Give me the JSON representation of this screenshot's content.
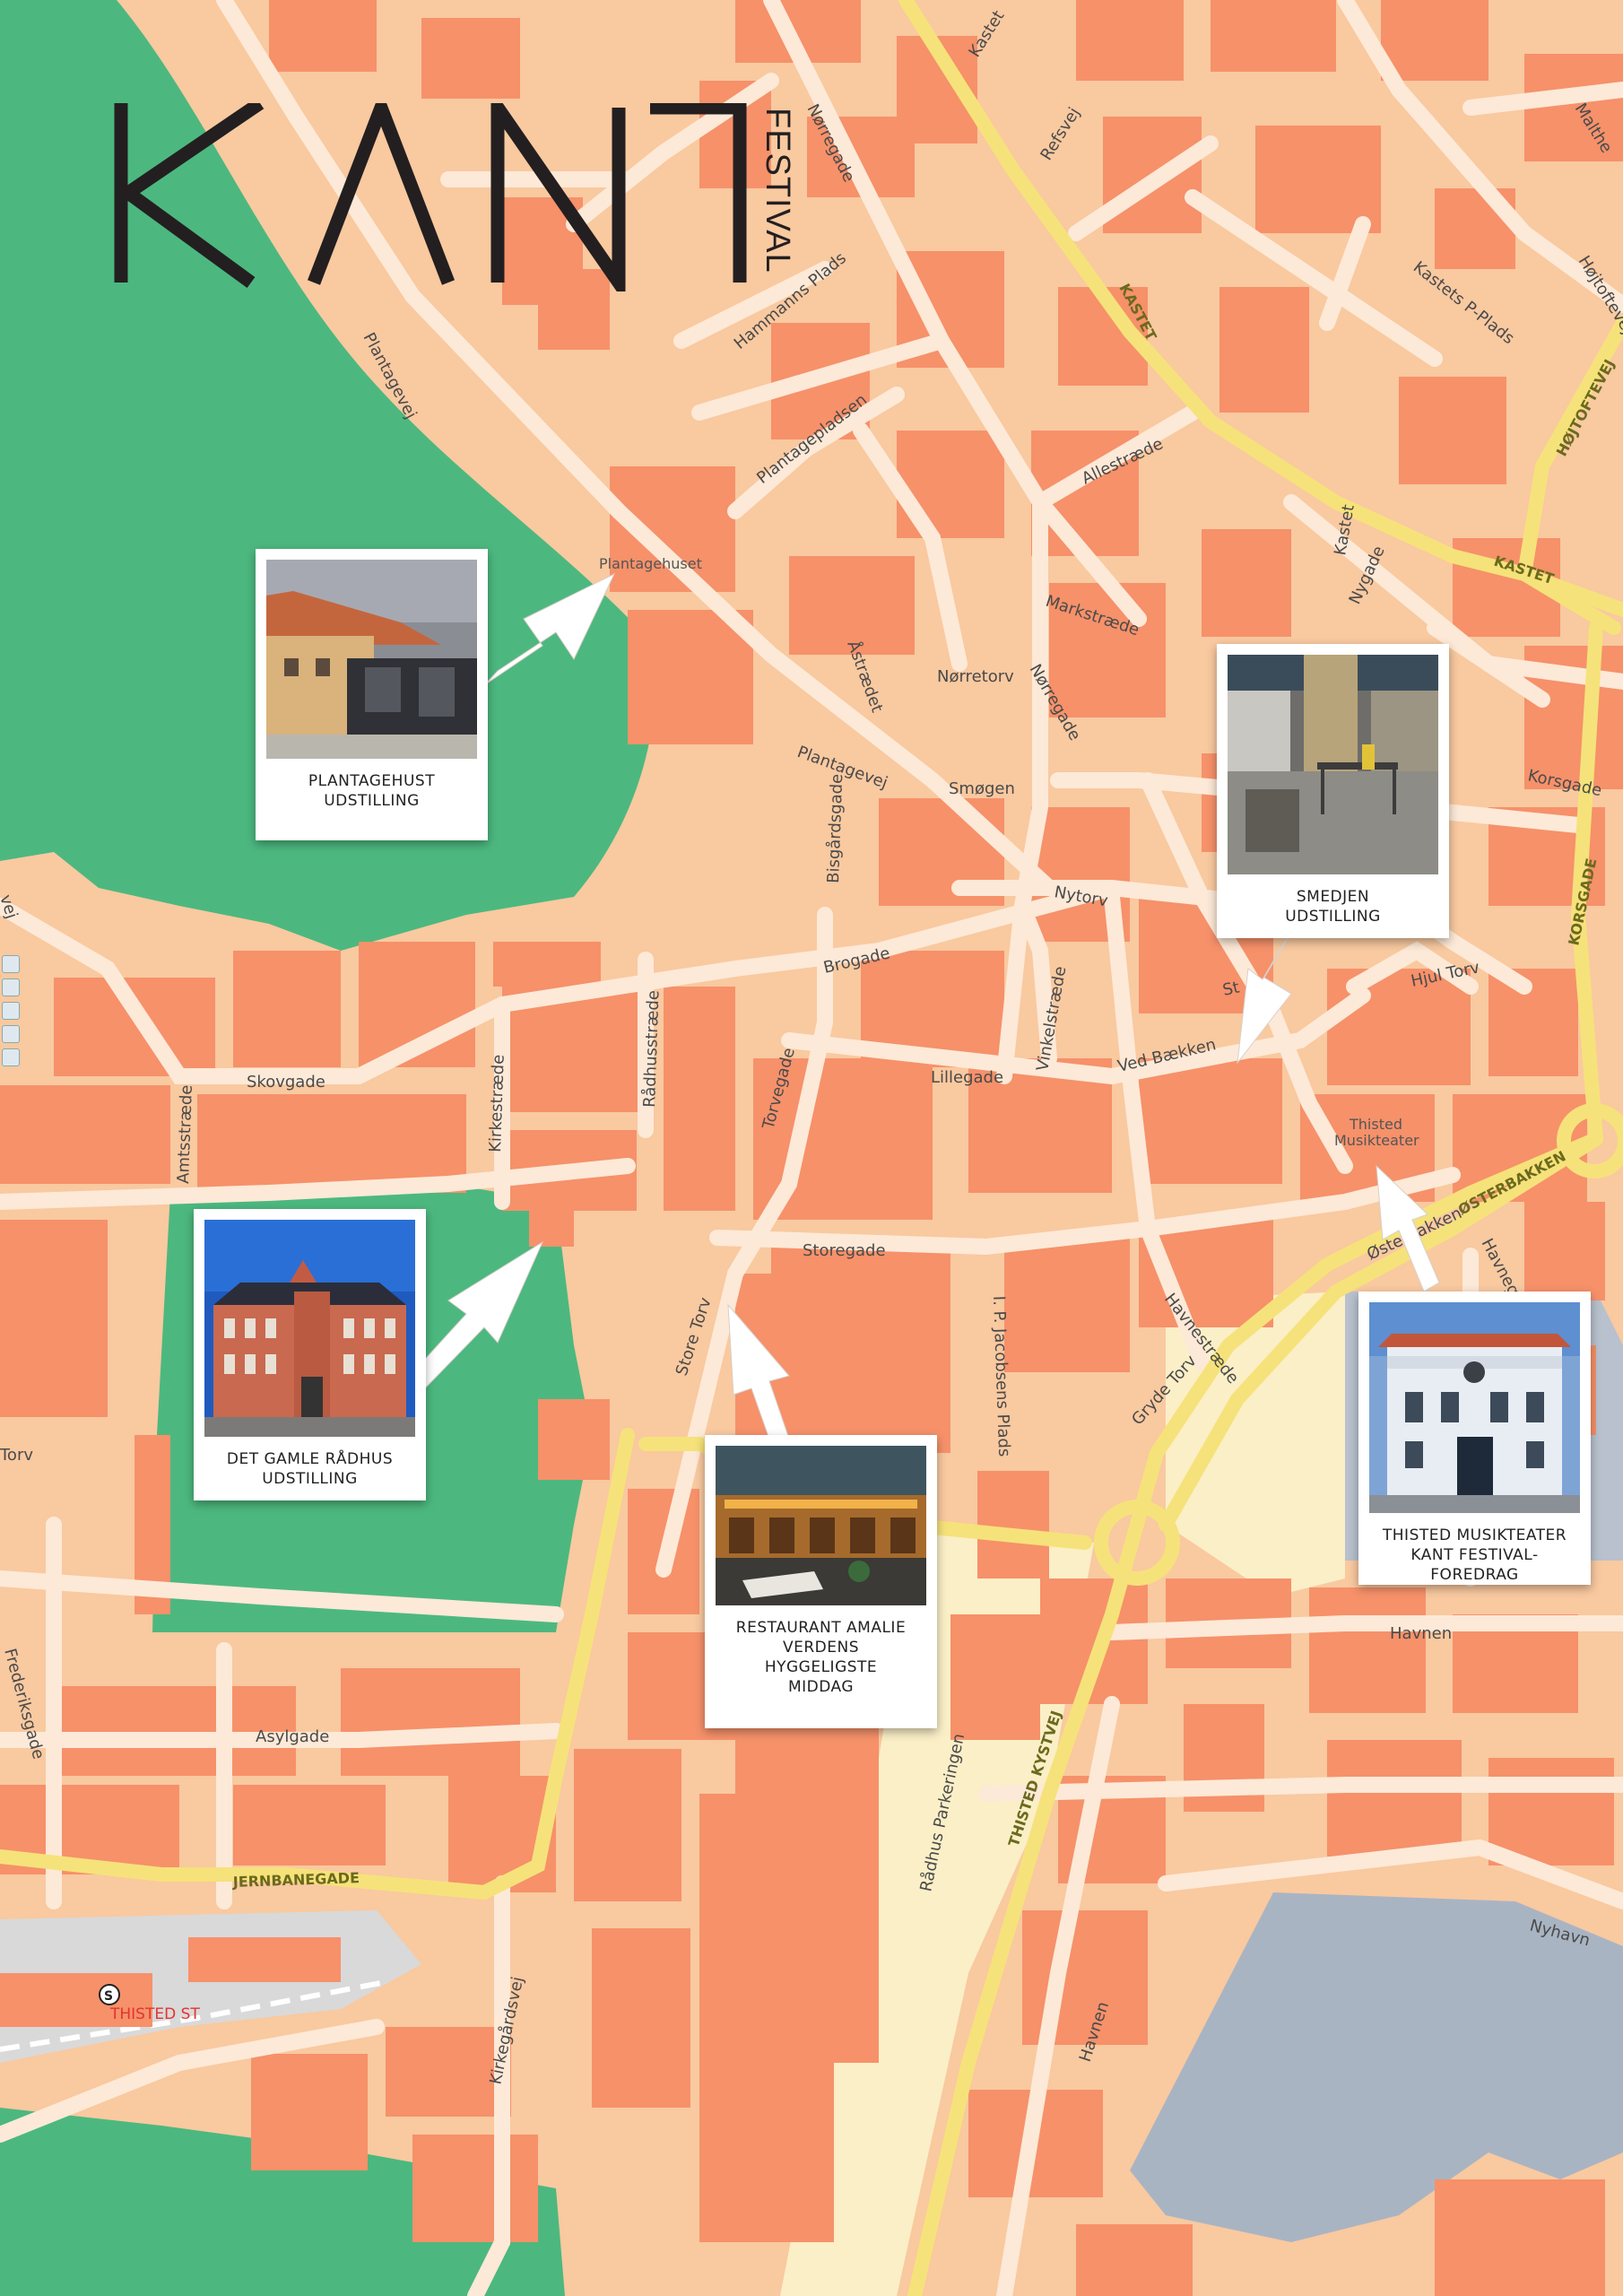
{
  "logo": {
    "word": "KANT",
    "side": "FESTIVAL"
  },
  "colors": {
    "park": "#4cb87f",
    "building": "#f6916a",
    "background": "#f9c9a0",
    "road": "#fce6d0",
    "major_road": "#f6e27a",
    "water": "#a9b4c3",
    "rail": "#d9d9d9",
    "arrow": "#ffffff"
  },
  "streets": [
    "Kastet",
    "Refsvej",
    "Nørregade",
    "Malthe",
    "Højtoftevej",
    "Kastets P-Plads",
    "KASTET",
    "HØJTOFTEVEJ",
    "Hammanns Plads",
    "Plantagevej",
    "Plantagepladsen",
    "Allestræde",
    "Kastet",
    "Nygade",
    "KASTET",
    "Markstræde",
    "Åstrædet",
    "Nørretorv",
    "Nørregade",
    "Plantagevej",
    "Smøgen",
    "Korsgade",
    "Bisgårdsgade",
    "Nytorv",
    "KORSGADE",
    "Brogade",
    "Hjul Torv",
    "Rådhusstræde",
    "Vinkelstræde",
    "Skovgade",
    "Lillegade",
    "Ved Bækken",
    "Kirkestræde",
    "Amtsstræde",
    "Torvegade",
    "ØSTERBAKKEN",
    "Østerbakken",
    "Havnegade",
    "Storegade",
    "Store Torv",
    "I. P. Jacobsens Plads",
    "Havnestræde",
    "Gryde Torv",
    "Torv",
    "Havnen",
    "Asylgade",
    "Rådhus Parkeringen",
    "THISTED KYSTVEJ",
    "JERNBANEGADE",
    "Nyhavn",
    "Kirkegårdsvej",
    "Havnen",
    "Frederiksgade",
    "vej",
    "St"
  ],
  "pois": {
    "plantagehuset": "Plantagehuset",
    "musikteater_1": "Thisted",
    "musikteater_2": "Musikteater",
    "station": "THISTED ST",
    "station_symbol": "S"
  },
  "cards": [
    {
      "id": "plantagehust",
      "caption": [
        "PLANTAGEHUST",
        "UDSTILLING"
      ]
    },
    {
      "id": "smedjen",
      "caption": [
        "SMEDJEN",
        "UDSTILLING"
      ]
    },
    {
      "id": "raadhus",
      "caption": [
        "DET GAMLE RÅDHUS",
        "UDSTILLING"
      ]
    },
    {
      "id": "amalie",
      "caption": [
        "RESTAURANT AMALIE",
        "VERDENS",
        "HYGGELIGSTE",
        "MIDDAG"
      ]
    },
    {
      "id": "musikteater",
      "caption": [
        "THISTED MUSIKTEATER",
        "KANT FESTIVAL- FOREDRAG"
      ]
    }
  ]
}
